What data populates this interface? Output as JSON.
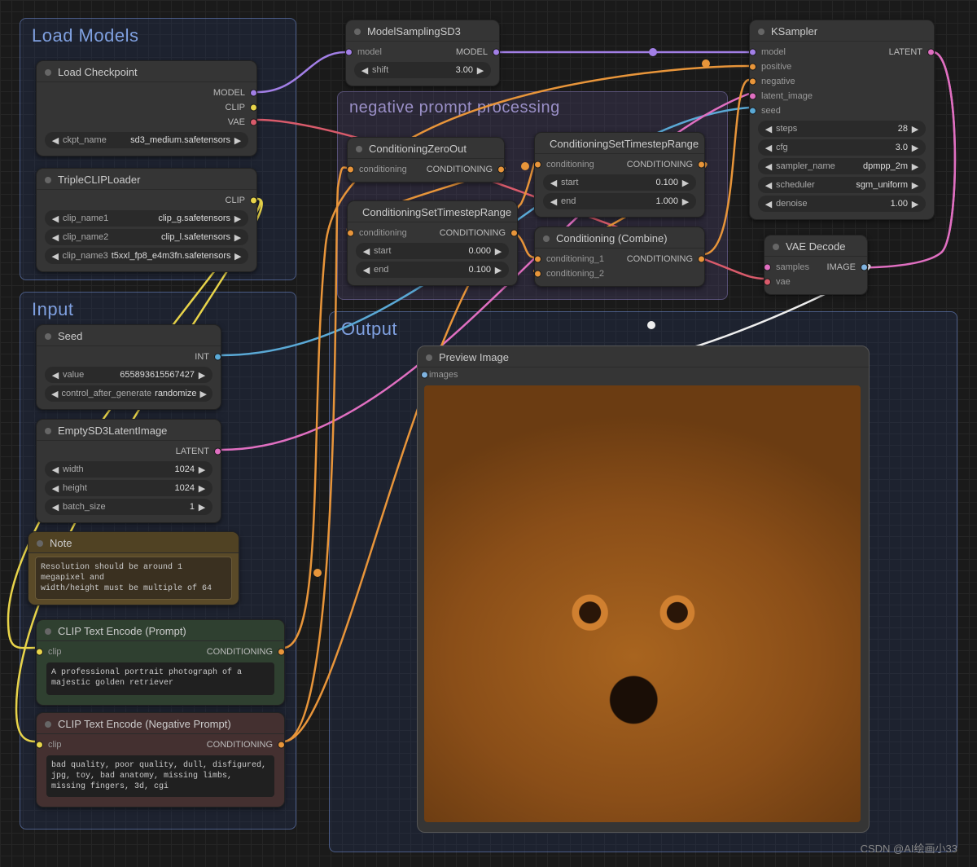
{
  "groups": {
    "load_models": "Load Models",
    "input": "Input",
    "neg": "negative prompt  processing",
    "output": "Output"
  },
  "nodes": {
    "modelSampling": {
      "title": "ModelSamplingSD3",
      "in_model": "model",
      "out_model": "MODEL",
      "shift_label": "shift",
      "shift_val": "3.00"
    },
    "ksampler": {
      "title": "KSampler",
      "in_model": "model",
      "in_pos": "positive",
      "in_neg": "negative",
      "in_latent": "latent_image",
      "in_seed": "seed",
      "out_latent": "LATENT",
      "steps_label": "steps",
      "steps_val": "28",
      "cfg_label": "cfg",
      "cfg_val": "3.0",
      "sampler_label": "sampler_name",
      "sampler_val": "dpmpp_2m",
      "sched_label": "scheduler",
      "sched_val": "sgm_uniform",
      "denoise_label": "denoise",
      "denoise_val": "1.00"
    },
    "loadckpt": {
      "title": "Load Checkpoint",
      "out_model": "MODEL",
      "out_clip": "CLIP",
      "out_vae": "VAE",
      "ckpt_label": "ckpt_name",
      "ckpt_val": "sd3_medium.safetensors"
    },
    "tripleclip": {
      "title": "TripleCLIPLoader",
      "out_clip": "CLIP",
      "c1_label": "clip_name1",
      "c1_val": "clip_g.safetensors",
      "c2_label": "clip_name2",
      "c2_val": "clip_l.safetensors",
      "c3_label": "clip_name3",
      "c3_val": "t5xxl_fp8_e4m3fn.safetensors"
    },
    "seed": {
      "title": "Seed",
      "out_int": "INT",
      "value_label": "value",
      "value_val": "655893615567427",
      "ctrl_label": "control_after_generate",
      "ctrl_val": "randomize"
    },
    "empty": {
      "title": "EmptySD3LatentImage",
      "out_latent": "LATENT",
      "w_label": "width",
      "w_val": "1024",
      "h_label": "height",
      "h_val": "1024",
      "b_label": "batch_size",
      "b_val": "1"
    },
    "note": {
      "title": "Note",
      "text": "Resolution should be around 1 megapixel and\nwidth/height must be multiple of 64"
    },
    "clipPos": {
      "title": "CLIP Text Encode (Prompt)",
      "in_clip": "clip",
      "out_cond": "CONDITIONING",
      "text": "A professional portrait photograph of a majestic golden retriever"
    },
    "clipNeg": {
      "title": "CLIP Text Encode (Negative Prompt)",
      "in_clip": "clip",
      "out_cond": "CONDITIONING",
      "text": "bad quality, poor quality, dull, disfigured, jpg, toy, bad anatomy, missing limbs, missing fingers, 3d, cgi"
    },
    "zeroOut": {
      "title": "ConditioningZeroOut",
      "in_cond": "conditioning",
      "out_cond": "CONDITIONING"
    },
    "tsr1": {
      "title": "ConditioningSetTimestepRange",
      "in_cond": "conditioning",
      "out_cond": "CONDITIONING",
      "start_label": "start",
      "start_val": "0.000",
      "end_label": "end",
      "end_val": "0.100"
    },
    "tsr2": {
      "title": "ConditioningSetTimestepRange",
      "in_cond": "conditioning",
      "out_cond": "CONDITIONING",
      "start_label": "start",
      "start_val": "0.100",
      "end_label": "end",
      "end_val": "1.000"
    },
    "combine": {
      "title": "Conditioning (Combine)",
      "in1": "conditioning_1",
      "in2": "conditioning_2",
      "out_cond": "CONDITIONING"
    },
    "vaedecode": {
      "title": "VAE Decode",
      "in_samples": "samples",
      "in_vae": "vae",
      "out_image": "IMAGE"
    },
    "preview": {
      "title": "Preview Image",
      "in_images": "images"
    }
  },
  "watermark": "CSDN @AI绘画小33"
}
